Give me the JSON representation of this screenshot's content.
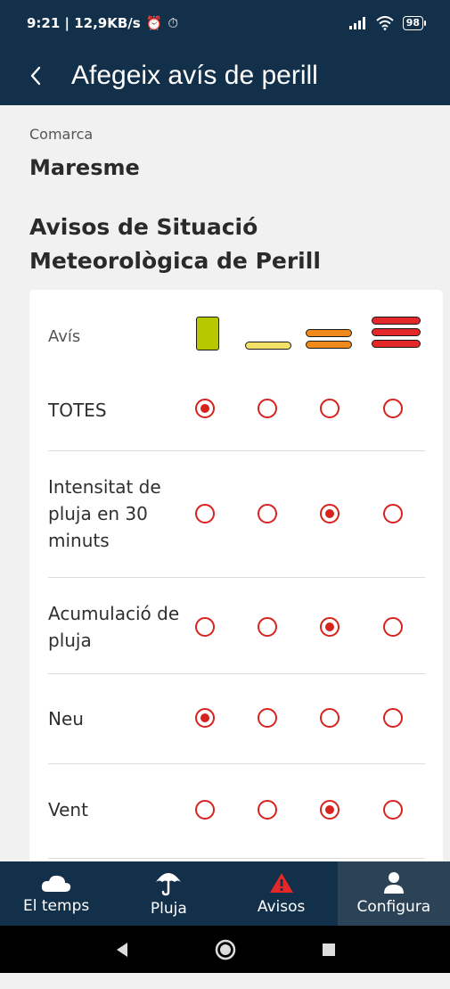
{
  "status_bar": {
    "time_speed": "9:21 | 12,9KB/s",
    "battery": "98"
  },
  "app_bar": {
    "title": "Afegeix avís de perill"
  },
  "county": {
    "label": "Comarca",
    "value": "Maresme"
  },
  "section_title": "Avisos de Situació Meteorològica de Perill",
  "table": {
    "header_label": "Avís",
    "levels": [
      {
        "icon": "level-1-green-square-icon",
        "color": "#b5c800"
      },
      {
        "icon": "level-2-yellow-bar-icon",
        "color": "#f4e16a"
      },
      {
        "icon": "level-3-orange-bars-icon",
        "color": "#f08a1a"
      },
      {
        "icon": "level-4-red-bars-icon",
        "color": "#e4282a"
      }
    ],
    "rows": [
      {
        "label": "TOTES",
        "selected": 0
      },
      {
        "label": "Intensitat de pluja en 30 minuts",
        "selected": 2
      },
      {
        "label": "Acumulació de pluja",
        "selected": 2
      },
      {
        "label": "Neu",
        "selected": 0
      },
      {
        "label": "Vent",
        "selected": 2
      }
    ]
  },
  "bottom_nav": {
    "items": [
      {
        "label": "El temps",
        "icon": "cloud-icon"
      },
      {
        "label": "Pluja",
        "icon": "umbrella-icon"
      },
      {
        "label": "Avisos",
        "icon": "warning-icon"
      },
      {
        "label": "Configura",
        "icon": "person-icon"
      }
    ],
    "active": 3
  },
  "colors": {
    "primary": "#13304a",
    "accent": "#d7221d",
    "background": "#f1f1f1"
  }
}
